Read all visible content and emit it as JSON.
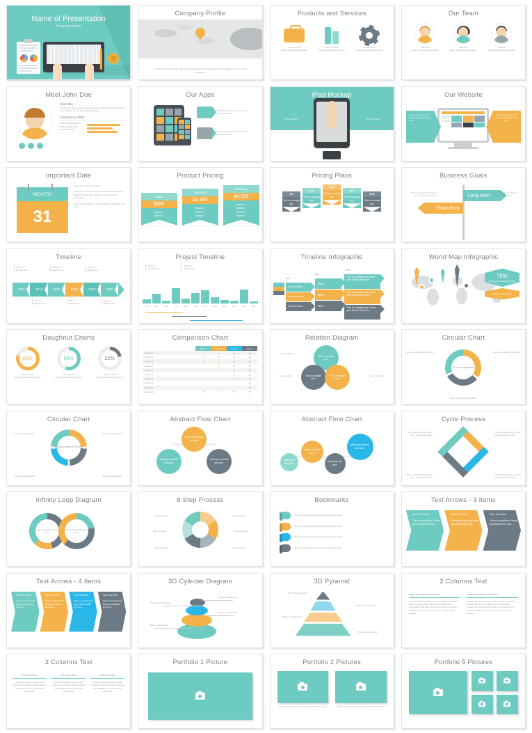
{
  "palette": {
    "teal": "#6ecbc2",
    "teal_light": "#8fd8d0",
    "teal_pale": "#a9e0da",
    "orange": "#f4b34a",
    "orange_dark": "#f0a01f",
    "slate": "#6b7a85",
    "slate_light": "#98a5ad",
    "blue": "#29b6e8",
    "grey_text": "#9aa1a4",
    "title_text": "#7b8285"
  },
  "common": {
    "your_text_here": "Your text here",
    "insert_desired": "Insert your desired text here.",
    "sample_short": "This is a sample text.",
    "sample_full": "This is a sample text. Insert your desired text here.",
    "sample_stack": "This is a sample text. Insert your desired text here.",
    "lorem_short": "Ut enim ad minim veniam, quis nostrud exercitation ullamco laboris nisi ut aliquip ex ea commodo consequat.",
    "lorem_long": "Ut enim ad minim veniam, quis nostrud exercitation ullamco laboris nisi ut aliquip ex ea commodo consequat. Duis aute irure dolor in reprehenderit in voluptate velit esse cillum dolore eu fugiat nulla pariatur.",
    "lorem_mid": "Ut enim ad minim veniam, quis nostrud exercitation ullamco laboris nisi ut aliquip ex ea commodo consequat."
  },
  "slides": [
    {
      "id": "title-slide",
      "title": "Name of Presentation",
      "subtitle": "Company Name"
    },
    {
      "id": "company-profile",
      "title": "Company Profile",
      "caption": "Ut enim ad minim veniam, quis nostrud exercitation ullamco laboris nisi ut aliquip ex ea commodo consequat."
    },
    {
      "id": "products-and-services",
      "title": "Products and Services",
      "items": [
        {
          "icon": "briefcase-icon",
          "heading": "Your text here",
          "text": "Insert your desired text here."
        },
        {
          "icon": "buildings-icon",
          "heading": "Your text here",
          "text": "Insert your desired text here."
        },
        {
          "icon": "gear-icon",
          "heading": "Your text here",
          "text": "Insert your desired text here."
        }
      ]
    },
    {
      "id": "our-team",
      "title": "Our Team",
      "members": [
        {
          "name": "John Doe",
          "text": "Insert your desired text here."
        },
        {
          "name": "Jane Doe",
          "text": "Insert your desired text here."
        },
        {
          "name": "John Doe",
          "text": "Insert your desired text here."
        }
      ]
    },
    {
      "id": "meet-john-doe",
      "title": "Meet John Doe",
      "bio_heading": "Short Bio",
      "bio_text": "Ut enim ad minim veniam, quis nostrud exercitation ullamco laboris nisi ut aliquip ex ea commodo consequat.",
      "skills_heading": "Expertise & Skills",
      "skills": [
        "Project Management",
        "Web Programming",
        "Graphic Design"
      ],
      "social": [
        "twitter-icon",
        "facebook-icon",
        "linkedin-icon"
      ]
    },
    {
      "id": "our-apps",
      "title": "Our Apps",
      "items": [
        {
          "text": "This is a sample text. Insert your desired text here."
        },
        {
          "text": "This is a sample text. Insert your desired text here."
        }
      ]
    },
    {
      "id": "ipad-mockup",
      "title": "iPad Mockup",
      "left_heading": "Your text here",
      "left_text": "Insert your desired text here.",
      "right_heading": "Your text here",
      "right_text": "Insert your desired text here."
    },
    {
      "id": "our-website",
      "title": "Our Website",
      "left_text": "This is a sample text. Insert your desired text here.",
      "right_text": "This is a sample text. Insert your desired text here."
    },
    {
      "id": "important-date",
      "title": "Important Date",
      "month": "MONTH",
      "day": "31",
      "line1": "Insert your desired text here.",
      "line2": "Ut enim ad minim veniam, quis nostrud exercitation ullamco laboris nisi ut aliquip ex ea commodo consequat.",
      "line3": "Duis aute irure dolor in reprehenderit in voluptate velit esse."
    },
    {
      "id": "product-pricing",
      "title": "Product Pricing",
      "plans": [
        {
          "name": "Basic",
          "price": "$995",
          "features": [
            "feature 1",
            "feature 2"
          ]
        },
        {
          "name": "Standard",
          "price": "$2,495",
          "features": [
            "feature 1",
            "feature 2",
            "feature 3"
          ]
        },
        {
          "name": "Premium",
          "price": "$4,995",
          "features": [
            "feature 1",
            "feature 2",
            "feature 3",
            "feature 4"
          ]
        }
      ]
    },
    {
      "id": "pricing-plans",
      "title": "Pricing Plans",
      "plans": [
        {
          "price": "$99",
          "text": "This is a sample text."
        },
        {
          "price": "$299",
          "text": "This is a sample text."
        },
        {
          "price": "$399",
          "text": "This is a sample text."
        },
        {
          "price": "$699",
          "text": "This is a sample text."
        },
        {
          "price": "$899",
          "text": "This is a sample text."
        }
      ]
    },
    {
      "id": "business-goals",
      "title": "Business Goals",
      "left_text": "This is a sample text. Insert your desired text here.",
      "right_text": "This is a sample text. Insert your desired text here.",
      "sign_top": "Long-term",
      "sign_bottom": "Short-term"
    },
    {
      "id": "timeline",
      "title": "Timeline",
      "years": [
        "2015",
        "2016",
        "2017",
        "2018",
        "2019",
        "2020"
      ],
      "highlight_year": "2018",
      "note": "This is a sample text."
    },
    {
      "id": "project-timeline",
      "title": "Project Timeline",
      "months": [
        "Jan",
        "Feb",
        "Mar",
        "Apr",
        "May",
        "Jun",
        "Jul",
        "Aug",
        "Sep",
        "Oct",
        "Nov",
        "Dec"
      ],
      "note_a": "This is a sample text.",
      "note_b": "This is a sample text."
    },
    {
      "id": "timeline-infographic",
      "title": "Timeline Infographic",
      "years": [
        "2016",
        "2017",
        "2018"
      ],
      "col1": [
        "Your text here",
        "Your text here",
        "Your text here"
      ],
      "col2": [
        {
          "icon": "chart-icon",
          "value": "70%",
          "sub": "(title)",
          "trend": "up"
        },
        {
          "icon": "clock-icon",
          "value": "25%",
          "sub": "(title)",
          "trend": "up"
        },
        {
          "icon": "gear-icon",
          "value": "-5%",
          "sub": "(title)",
          "trend": "down"
        }
      ],
      "col3": [
        {
          "icon": "thumbup-icon",
          "text": "This is a sample text. Insert your desired text here."
        },
        {
          "icon": "target-icon",
          "text": "This is a sample text. Insert your desired text here."
        },
        {
          "icon": "briefcase-icon",
          "text": "This is a sample text. Insert your desired text here."
        }
      ]
    },
    {
      "id": "world-map-infographic",
      "title": "World Map Infographic",
      "stat": "79%",
      "stat_text": "Insert your desired text here.",
      "sub_text": "This is a sample text."
    },
    {
      "id": "doughnut-charts",
      "title": "Doughnut Charts",
      "items": [
        {
          "value": "80%",
          "pct": 80,
          "color": "#f4b34a",
          "heading": "Your text here",
          "text": "Insert your desired text here."
        },
        {
          "value": "55%",
          "pct": 55,
          "color": "#6ecbc2",
          "heading": "Your text here",
          "text": "Insert your desired text here."
        },
        {
          "value": "22%",
          "pct": 22,
          "color": "#6b7a85",
          "heading": "Your text here",
          "text": "Insert your desired text here."
        }
      ]
    },
    {
      "id": "comparison-chart",
      "title": "Comparison Chart",
      "columns": [
        "Item 1",
        "Item 2",
        "Item 3",
        "Item 4"
      ],
      "column_colors": [
        "#6ecbc2",
        "#f4b34a",
        "#29b6e8",
        "#6b7a85"
      ],
      "rows": [
        {
          "label": "Feature 1",
          "checks": [
            false,
            true,
            true,
            true
          ]
        },
        {
          "label": "Feature 2",
          "checks": [
            true,
            true,
            true,
            true
          ]
        },
        {
          "label": "Feature 3",
          "checks": [
            true,
            true,
            true,
            true
          ]
        },
        {
          "label": "Feature 4",
          "checks": [
            false,
            true,
            true,
            true
          ]
        },
        {
          "label": "Feature 5",
          "checks": [
            false,
            true,
            true,
            true
          ]
        },
        {
          "label": "Feature 6",
          "checks": [
            false,
            false,
            true,
            true
          ]
        },
        {
          "label": "Feature 7",
          "checks": [
            false,
            false,
            true,
            true
          ]
        },
        {
          "label": "Feature 8",
          "checks": [
            false,
            false,
            false,
            true
          ]
        },
        {
          "label": "Feature 9",
          "checks": [
            false,
            false,
            false,
            true
          ]
        },
        {
          "label": "Feature 10",
          "checks": [
            true,
            true,
            true,
            true
          ]
        }
      ]
    },
    {
      "id": "relation-diagram",
      "title": "Relation Diagram",
      "bubbles": [
        {
          "text": "This is a sample text.",
          "color": "#6ecbc2"
        },
        {
          "text": "This is a sample text.",
          "color": "#6b7a85"
        },
        {
          "text": "This is a sample text.",
          "color": "#f4b34a"
        }
      ],
      "labels": [
        "Your text here",
        "Your text here",
        "Your text here"
      ]
    },
    {
      "id": "circular-chart-3",
      "title": "Circular Chart",
      "center": "This is a sample text.",
      "labels": [
        "Insert your desired text here.",
        "Insert your desired text here.",
        "Insert your desired text here."
      ]
    },
    {
      "id": "circular-chart-4",
      "title": "Circular Chart",
      "center": "Insert your desired text here.",
      "labels": [
        "This is a sample text.",
        "This is a sample text.",
        "This is a sample text.",
        "This is a sample text."
      ]
    },
    {
      "id": "abstract-flow-chart-3",
      "title": "Abstract Flow Chart",
      "nodes": [
        {
          "text": "Insert your desired text here.",
          "color": "#f4b34a"
        },
        {
          "text": "Insert your desired text here.",
          "color": "#6ecbc2"
        },
        {
          "text": "Insert your desired text here.",
          "color": "#6b7a85"
        }
      ]
    },
    {
      "id": "abstract-flow-chart-4",
      "title": "Abstract Flow Chart",
      "nodes": [
        {
          "text": "Insert your text here.",
          "color": "#8fd8d0"
        },
        {
          "text": "Insert your text here.",
          "color": "#f4b34a"
        },
        {
          "text": "Insert your text here.",
          "color": "#6b7a85"
        },
        {
          "text": "Insert your desired text here.",
          "color": "#29b6e8"
        }
      ]
    },
    {
      "id": "cycle-process",
      "title": "Cycle Process",
      "labels": [
        "This is a sample text. Insert your desired text here.",
        "This is a sample text. Insert your desired text here.",
        "This is a sample text. Insert your desired text here.",
        "This is a sample text. Insert your desired text here."
      ]
    },
    {
      "id": "infinity-loop-diagram",
      "title": "Infinity Loop Diagram",
      "left_text": "Insert your desired text here.",
      "right_text": "Insert your desired text here."
    },
    {
      "id": "six-step-process",
      "title": "6 Step Process",
      "labels": [
        "Your text here",
        "Your text here",
        "Your text here",
        "Your text here",
        "Your text here",
        "Your text here"
      ],
      "colors": [
        "#6ecbc2",
        "#f7cd8c",
        "#f4b34a",
        "#a7b4ba",
        "#6b7a85",
        "#b6e2dd"
      ]
    },
    {
      "id": "bookmarks",
      "title": "Bookmarks",
      "items": [
        {
          "color": "#6ecbc2",
          "text": "This is a sample text. Insert your desired text here."
        },
        {
          "color": "#f4b34a",
          "text": "This is a sample text. Insert your desired text here."
        },
        {
          "color": "#29b6e8",
          "text": "This is a sample text. Insert your desired text here."
        },
        {
          "color": "#6b7a85",
          "text": "This is a sample text. Insert your desired text here."
        }
      ]
    },
    {
      "id": "text-arrows-3-items",
      "title": "Text Arrows - 3 Items",
      "items": [
        {
          "heading": "Your text here",
          "text": "This is a sample text. Insert your desired text here.",
          "color": "#6ecbc2"
        },
        {
          "heading": "Your text here",
          "text": "This is a sample text. Insert your desired text here.",
          "color": "#f4b34a"
        },
        {
          "heading": "Your text here",
          "text": "This is a sample text. Insert your desired text here.",
          "color": "#6b7a85"
        }
      ]
    },
    {
      "id": "text-arrows-4-items",
      "title": "Text Arrows - 4 Items",
      "items": [
        {
          "heading": "Your text here",
          "text": "This is a sample text. Insert your desired text here.",
          "color": "#6ecbc2"
        },
        {
          "heading": "Your text here",
          "text": "This is a sample text. Insert your desired text here.",
          "color": "#f4b34a"
        },
        {
          "heading": "Your text here",
          "text": "This is a sample text. Insert your desired text here.",
          "color": "#29b6e8"
        },
        {
          "heading": "Your text here",
          "text": "This is a sample text. Insert your desired text here.",
          "color": "#6b7a85"
        }
      ]
    },
    {
      "id": "3d-cylinder-diagram",
      "title": "3D Cylinder Diagram",
      "labels": [
        "This is a sample text.",
        "This is a sample text.",
        "This is a sample text.",
        "This is a sample text."
      ]
    },
    {
      "id": "3d-pyramid",
      "title": "3D Pyramid",
      "labels": [
        "This is a sample text.",
        "This is a sample text.",
        "This is a sample text.",
        "This is a sample text."
      ]
    },
    {
      "id": "2-columns-text",
      "title": "2 Columns Text",
      "columns": [
        {
          "heading": "Insert your desired text here.",
          "body": "Ut enim ad minim veniam, quis nostrud exercitation ullamco laboris nisi ut aliquip ex ea commodo consequat. Duis aute irure dolor in reprehenderit in voluptate velit esse cillum dolore eu fugiat nulla pariatur."
        },
        {
          "heading": "Insert your desired text here.",
          "body": "Ut enim ad minim veniam, quis nostrud exercitation ullamco laboris nisi ut aliquip ex ea commodo consequat. Duis aute irure dolor in reprehenderit in voluptate velit esse cillum dolore eu fugiat nulla pariatur."
        }
      ]
    },
    {
      "id": "3-columns-text",
      "title": "3 Columns Text",
      "columns": [
        {
          "heading": "Your text here",
          "body": "Ut enim ad minim veniam, quis nostrud exercitation ullamco laboris nisi ut aliquip ex ea commodo consequat."
        },
        {
          "heading": "Your text here",
          "body": "Ut enim ad minim veniam, quis nostrud exercitation ullamco laboris nisi ut aliquip ex ea commodo consequat."
        },
        {
          "heading": "Your text here",
          "body": "Ut enim ad minim veniam, quis nostrud exercitation ullamco laboris nisi ut aliquip ex ea commodo consequat."
        }
      ]
    },
    {
      "id": "portfolio-1-picture",
      "title": "Portfolio 1 Picture",
      "placeholder_icon": "camera-icon"
    },
    {
      "id": "portfolio-2-pictures",
      "title": "Portfolio 2 Pictures",
      "captions": [
        "This is a sample text. Insert your desired text here.",
        "This is a sample text. Insert your desired text here."
      ]
    },
    {
      "id": "portfolio-5-pictures",
      "title": "Portfolio 5 Pictures",
      "placeholder_icon": "camera-icon"
    }
  ]
}
